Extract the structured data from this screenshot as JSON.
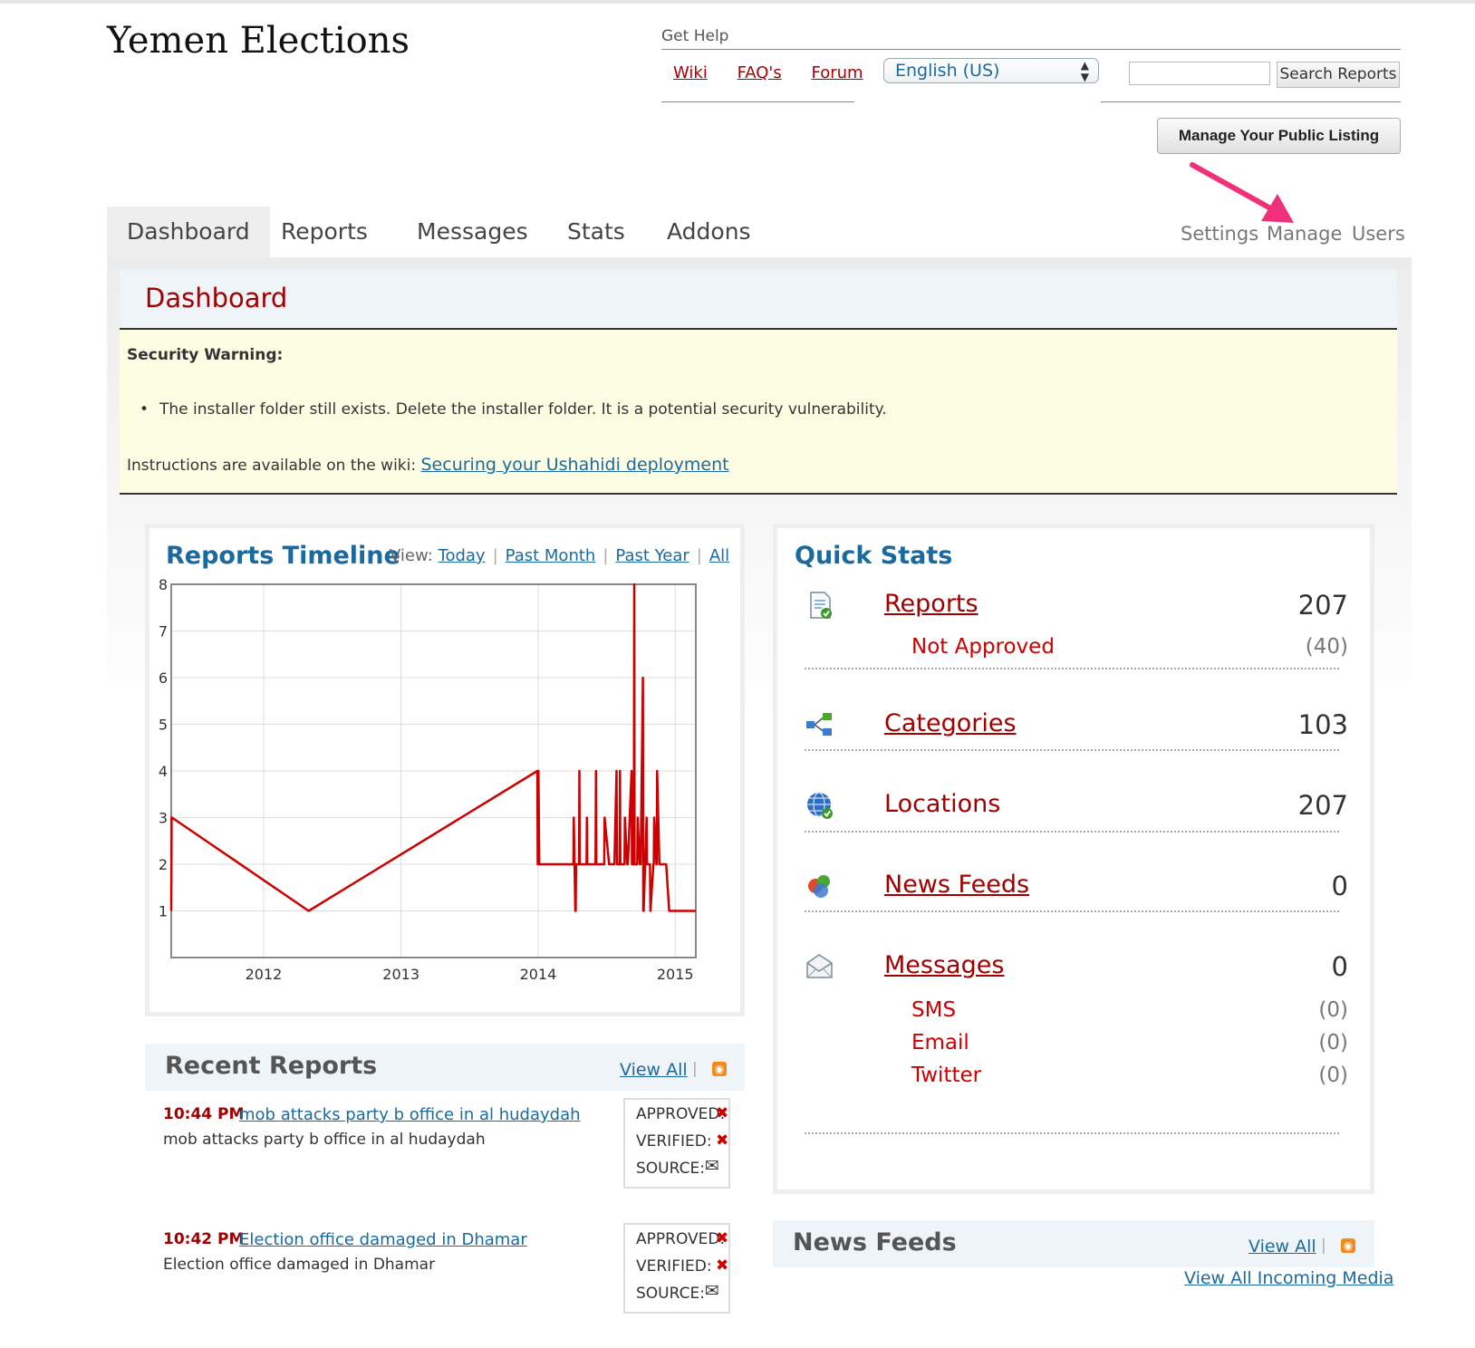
{
  "site": {
    "title": "Yemen Elections"
  },
  "help": {
    "label": "Get Help",
    "links": [
      "Wiki",
      "FAQ's",
      "Forum"
    ],
    "language": "English (US)",
    "search_button": "Search Reports",
    "manage_listing": "Manage Your Public Listing"
  },
  "nav": {
    "tabs": [
      "Dashboard",
      "Reports",
      "Messages",
      "Stats",
      "Addons"
    ],
    "active": "Dashboard",
    "secondary": [
      "Settings",
      "Manage",
      "Users"
    ]
  },
  "dashboard": {
    "title": "Dashboard",
    "warning": {
      "title": "Security Warning:",
      "item": "The installer folder still exists. Delete the installer folder. It is a potential security vulnerability.",
      "instructions": "Instructions are available on the wiki:",
      "link": "Securing your Ushahidi deployment"
    }
  },
  "timeline": {
    "title": "Reports Timeline",
    "view_label": "View:",
    "views": [
      "Today",
      "Past Month",
      "Past Year",
      "All"
    ]
  },
  "chart_data": {
    "type": "line",
    "title": "Reports Timeline",
    "xlabel": "",
    "ylabel": "",
    "x_ticks": [
      "2012",
      "2013",
      "2014",
      "2015"
    ],
    "y_ticks": [
      1,
      2,
      3,
      4,
      5,
      6,
      7,
      8
    ],
    "ylim": [
      0,
      8
    ],
    "xlim": [
      "2011-04-30",
      "2015-02-25"
    ],
    "grid": true,
    "color": "#cc0000",
    "series": [
      {
        "x": [
          "2011-04-30",
          "2011-05-01",
          "2011-05-02",
          "2012-04-30",
          "2013-12-30",
          "2013-12-31",
          "2014-01-01",
          "2014-01-02",
          "2014-01-04",
          "2014-01-05",
          "2014-01-06",
          "2014-01-08",
          "2014-01-09",
          "2014-01-10",
          "2014-01-12",
          "2014-01-15",
          "2014-01-17",
          "2014-01-28",
          "2014-01-29",
          "2014-01-30",
          "2014-02-01",
          "2014-02-03",
          "2014-02-05",
          "2014-02-06",
          "2014-02-08",
          "2014-02-18",
          "2014-02-19",
          "2014-02-20",
          "2014-03-01",
          "2014-03-03",
          "2014-03-05",
          "2014-03-06",
          "2014-03-08",
          "2014-04-04",
          "2014-04-05",
          "2014-04-06",
          "2014-04-10",
          "2014-04-11",
          "2014-04-12",
          "2014-04-20",
          "2014-04-21",
          "2014-04-22",
          "2014-05-03",
          "2014-05-04",
          "2014-05-05",
          "2014-05-10",
          "2014-05-11",
          "2014-05-12",
          "2014-05-18",
          "2014-05-19",
          "2014-05-20",
          "2014-05-26",
          "2014-05-27",
          "2014-05-28",
          "2014-06-03",
          "2014-06-04",
          "2014-06-05",
          "2014-06-11",
          "2014-06-12",
          "2014-06-13",
          "2014-06-25",
          "2014-06-26",
          "2014-06-27",
          "2014-07-09",
          "2014-07-10",
          "2014-07-11",
          "2014-07-21",
          "2014-07-22",
          "2014-07-23",
          "2014-07-29",
          "2014-07-30",
          "2014-07-31",
          "2014-08-06",
          "2014-08-07",
          "2014-08-08",
          "2014-08-18",
          "2014-08-19",
          "2014-08-20",
          "2014-08-26",
          "2014-08-27",
          "2014-08-28",
          "2014-09-07",
          "2014-09-08",
          "2014-09-09",
          "2014-09-13",
          "2014-09-14",
          "2014-09-15",
          "2014-09-21",
          "2014-09-22",
          "2014-09-23",
          "2014-09-29",
          "2014-09-30",
          "2014-10-01",
          "2014-10-07",
          "2014-10-08",
          "2014-10-09",
          "2014-10-17",
          "2014-10-18",
          "2014-10-19",
          "2014-10-25",
          "2014-10-26",
          "2014-10-27",
          "2014-11-04",
          "2014-11-05",
          "2014-11-06",
          "2014-11-12",
          "2014-11-13",
          "2014-11-14",
          "2014-11-20",
          "2014-11-21",
          "2014-11-22",
          "2014-11-28",
          "2014-11-29",
          "2014-11-30",
          "2014-12-06",
          "2014-12-07",
          "2014-12-08",
          "2014-12-16",
          "2014-12-17",
          "2014-12-18",
          "2014-12-28",
          "2014-12-29",
          "2014-12-30",
          "2015-01-07",
          "2015-01-08",
          "2015-01-09",
          "2015-01-21",
          "2015-01-22",
          "2015-01-23",
          "2015-02-25"
        ],
        "y": [
          1,
          3,
          3,
          1,
          4,
          2,
          2,
          4,
          2,
          2,
          2,
          2,
          2,
          2,
          2,
          2,
          2,
          2,
          2,
          2,
          2,
          2,
          2,
          2,
          2,
          2,
          2,
          2,
          2,
          2,
          2,
          2,
          2,
          2,
          2,
          3,
          1,
          1,
          2,
          2,
          4,
          2,
          2,
          2,
          2,
          2,
          3,
          2,
          2,
          2,
          2,
          2,
          2,
          2,
          2,
          4,
          2,
          2,
          2,
          2,
          2,
          2,
          3,
          2,
          2,
          2,
          2,
          2,
          2,
          4,
          2,
          2,
          2,
          4,
          2,
          2,
          2,
          3,
          2,
          2,
          2,
          4,
          2,
          2,
          2,
          8,
          2,
          2,
          2,
          3,
          2,
          2,
          2,
          6,
          1,
          1,
          3,
          2,
          2,
          2,
          2,
          1,
          2,
          2,
          3,
          2,
          2,
          4,
          2,
          2,
          2,
          2,
          2,
          2,
          2,
          2,
          2,
          1,
          1,
          1,
          1,
          1,
          1,
          1,
          1,
          1,
          1,
          1,
          1,
          1
        ]
      }
    ]
  },
  "quick_stats": {
    "title": "Quick Stats",
    "rows": [
      {
        "label": "Reports",
        "value": "207",
        "icon": "report-icon"
      },
      {
        "label": "Categories",
        "value": "103",
        "icon": "categories-icon"
      },
      {
        "label": "Locations",
        "value": "207",
        "icon": "globe-icon"
      },
      {
        "label": "News Feeds",
        "value": "0",
        "icon": "news-feeds-icon"
      },
      {
        "label": "Messages",
        "value": "0",
        "icon": "envelope-icon"
      }
    ],
    "not_approved": {
      "label": "Not Approved",
      "value": "(40)"
    },
    "message_types": [
      {
        "label": "SMS",
        "value": "(0)"
      },
      {
        "label": "Email",
        "value": "(0)"
      },
      {
        "label": "Twitter",
        "value": "(0)"
      }
    ]
  },
  "recent_reports": {
    "title": "Recent Reports",
    "view_all": "View All",
    "separator": "|",
    "items": [
      {
        "time": "10:44 PM",
        "title": "mob attacks party b office in al hudaydah",
        "desc": "mob attacks party b office in al hudaydah",
        "approved": "APPROVED:",
        "verified": "VERIFIED:",
        "source": "SOURCE:"
      },
      {
        "time": "10:42 PM",
        "title": "Election office damaged in Dhamar",
        "desc": "Election office damaged in Dhamar",
        "approved": "APPROVED:",
        "verified": "VERIFIED:",
        "source": "SOURCE:"
      }
    ]
  },
  "news_feeds": {
    "title": "News Feeds",
    "view_all": "View All",
    "separator": "|",
    "incoming": "View All Incoming Media"
  }
}
